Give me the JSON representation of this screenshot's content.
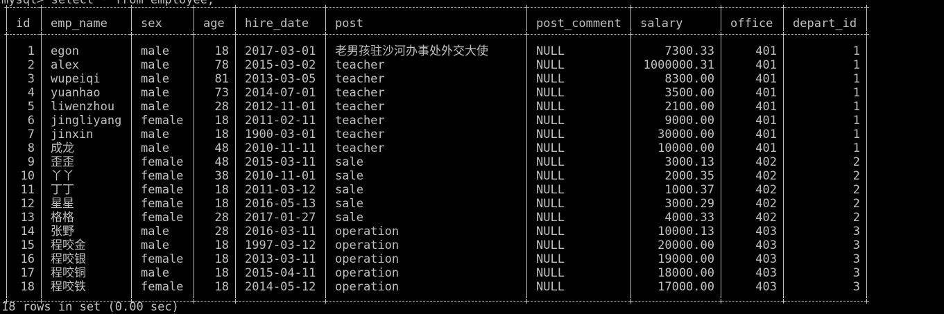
{
  "terminal": {
    "background": "#000000",
    "foreground": "#c0c0c0",
    "prompt_text": "mysql> select * from employee;",
    "footer_text": "18 rows in set (0.00 sec)"
  },
  "result_table": {
    "columns": [
      "id",
      "emp_name",
      "sex",
      "age",
      "hire_date",
      "post",
      "post_comment",
      "salary",
      "office",
      "depart_id"
    ],
    "rows": [
      [
        "1",
        "egon",
        "male",
        "18",
        "2017-03-01",
        "老男孩驻沙河办事处外交大使",
        "NULL",
        "7300.33",
        "401",
        "1"
      ],
      [
        "2",
        "alex",
        "male",
        "78",
        "2015-03-02",
        "teacher",
        "NULL",
        "1000000.31",
        "401",
        "1"
      ],
      [
        "3",
        "wupeiqi",
        "male",
        "81",
        "2013-03-05",
        "teacher",
        "NULL",
        "8300.00",
        "401",
        "1"
      ],
      [
        "4",
        "yuanhao",
        "male",
        "73",
        "2014-07-01",
        "teacher",
        "NULL",
        "3500.00",
        "401",
        "1"
      ],
      [
        "5",
        "liwenzhou",
        "male",
        "28",
        "2012-11-01",
        "teacher",
        "NULL",
        "2100.00",
        "401",
        "1"
      ],
      [
        "6",
        "jingliyang",
        "female",
        "18",
        "2011-02-11",
        "teacher",
        "NULL",
        "9000.00",
        "401",
        "1"
      ],
      [
        "7",
        "jinxin",
        "male",
        "18",
        "1900-03-01",
        "teacher",
        "NULL",
        "30000.00",
        "401",
        "1"
      ],
      [
        "8",
        "成龙",
        "male",
        "48",
        "2010-11-11",
        "teacher",
        "NULL",
        "10000.00",
        "401",
        "1"
      ],
      [
        "9",
        "歪歪",
        "female",
        "48",
        "2015-03-11",
        "sale",
        "NULL",
        "3000.13",
        "402",
        "2"
      ],
      [
        "10",
        "丫丫",
        "female",
        "38",
        "2010-11-01",
        "sale",
        "NULL",
        "2000.35",
        "402",
        "2"
      ],
      [
        "11",
        "丁丁",
        "female",
        "18",
        "2011-03-12",
        "sale",
        "NULL",
        "1000.37",
        "402",
        "2"
      ],
      [
        "12",
        "星星",
        "female",
        "18",
        "2016-05-13",
        "sale",
        "NULL",
        "3000.29",
        "402",
        "2"
      ],
      [
        "13",
        "格格",
        "female",
        "28",
        "2017-01-27",
        "sale",
        "NULL",
        "4000.33",
        "402",
        "2"
      ],
      [
        "14",
        "张野",
        "male",
        "28",
        "2016-03-11",
        "operation",
        "NULL",
        "10000.13",
        "403",
        "3"
      ],
      [
        "15",
        "程咬金",
        "male",
        "18",
        "1997-03-12",
        "operation",
        "NULL",
        "20000.00",
        "403",
        "3"
      ],
      [
        "16",
        "程咬银",
        "female",
        "18",
        "2013-03-11",
        "operation",
        "NULL",
        "19000.00",
        "403",
        "3"
      ],
      [
        "17",
        "程咬铜",
        "male",
        "18",
        "2015-04-11",
        "operation",
        "NULL",
        "18000.00",
        "403",
        "3"
      ],
      [
        "18",
        "程咬铁",
        "female",
        "18",
        "2014-05-12",
        "operation",
        "NULL",
        "17000.00",
        "403",
        "3"
      ]
    ]
  }
}
